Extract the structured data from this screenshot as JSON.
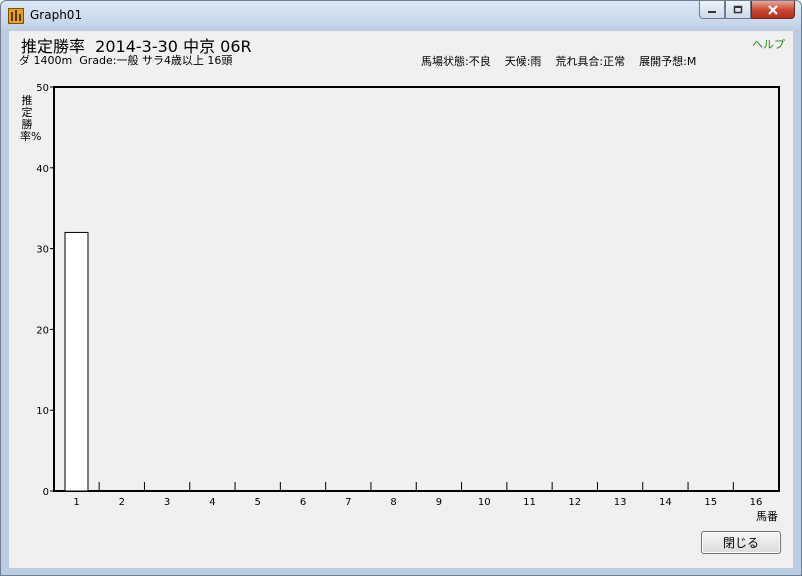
{
  "window": {
    "title": "Graph01",
    "app_icon": "horse-app-icon",
    "controls": [
      "minimize-icon",
      "maximize-icon",
      "close-icon"
    ]
  },
  "header": {
    "title": "推定勝率  2014-3-30 中京 06R",
    "race_info": "ダ 1400m  Grade:一般 サラ4歳以上 16頭",
    "help_label": "ヘルプ",
    "conditions": [
      "馬場状態:不良",
      "天候:雨",
      "荒れ具合:正常",
      "展開予想:M"
    ]
  },
  "footer": {
    "close_label": "閉じる"
  },
  "colors": {
    "help_link": "#1e8a1e",
    "bar_fill": "#ffffff",
    "axis": "#000000"
  },
  "chart_data": {
    "type": "bar",
    "ylabel": "推定勝率%",
    "xlabel": "馬番",
    "ylim": [
      0,
      50
    ],
    "yticks": [
      0,
      10,
      20,
      30,
      40,
      50
    ],
    "categories": [
      "1",
      "2",
      "3",
      "4",
      "5",
      "6",
      "7",
      "8",
      "9",
      "10",
      "11",
      "12",
      "13",
      "14",
      "15",
      "16"
    ],
    "values": [
      32,
      0,
      0,
      0,
      0,
      0,
      0,
      0,
      0,
      0,
      0,
      0,
      0,
      0,
      0,
      0
    ],
    "grid": false,
    "legend": "none"
  }
}
